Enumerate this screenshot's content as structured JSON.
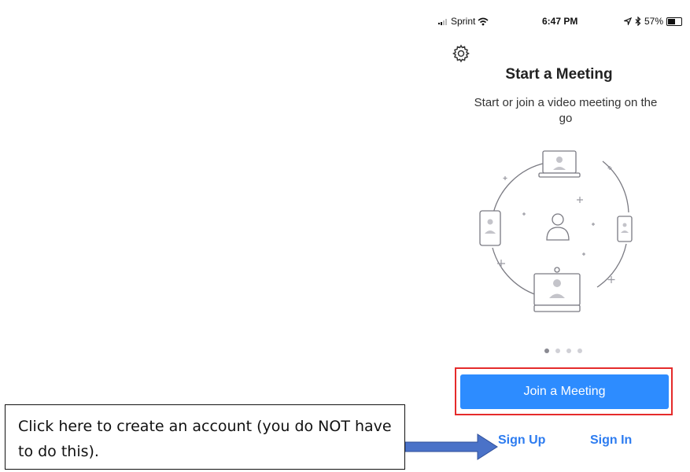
{
  "status_bar": {
    "carrier": "Sprint",
    "time": "6:47 PM",
    "battery": "57%",
    "battery_level": 0.57
  },
  "header": {
    "title": "Start a Meeting",
    "subtitle": "Start or join a video meeting on the go"
  },
  "carousel": {
    "page_count": 4,
    "active_page": 1
  },
  "actions": {
    "join_label": "Join a Meeting",
    "signup_label": "Sign Up",
    "signin_label": "Sign In"
  },
  "annotation": {
    "callout_text": "Click here to create an account (you do NOT have to do this).",
    "highlight_color": "#e52b2b",
    "arrow_color": "#4a72c8"
  },
  "colors": {
    "accent": "#2d8cff",
    "link": "#2d7cf0"
  },
  "icons": [
    "signal-icon",
    "wifi-icon",
    "location-icon",
    "bluetooth-icon",
    "battery-icon",
    "gear-icon",
    "meeting-illustration"
  ]
}
